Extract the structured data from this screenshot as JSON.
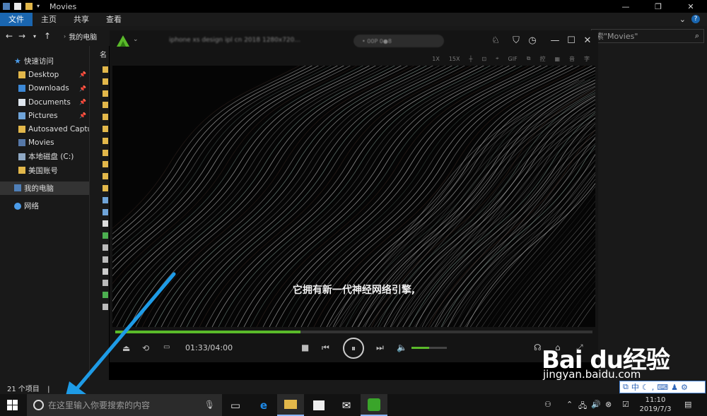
{
  "window": {
    "title": "Movies"
  },
  "ribbon": {
    "tabs": [
      "文件",
      "主页",
      "共享",
      "查看"
    ]
  },
  "search": {
    "placeholder": "索\"Movies\""
  },
  "address": {
    "crumb": "我的电脑"
  },
  "sidebar": {
    "quick_access": "快速访问",
    "items": [
      {
        "label": "Desktop",
        "pinned": true
      },
      {
        "label": "Downloads",
        "pinned": true
      },
      {
        "label": "Documents",
        "pinned": true
      },
      {
        "label": "Pictures",
        "pinned": true
      },
      {
        "label": "Autosaved Capture",
        "pinned": false
      },
      {
        "label": "Movies",
        "pinned": false
      },
      {
        "label": "本地磁盘 (C:)",
        "pinned": false
      },
      {
        "label": "美国账号",
        "pinned": false
      }
    ],
    "this_pc": "我的电脑",
    "network": "网络"
  },
  "filelist": {
    "header": "名"
  },
  "status": {
    "count": "21 个项目"
  },
  "player": {
    "title": "iphone xs design ipl cn 2018 1280x720...",
    "badge": "• 00P 0●8",
    "subtitle": "它拥有新一代神经网络引擎,",
    "time": "01:33/04:00",
    "progress": 0.388,
    "volume": 0.5,
    "tools": [
      "1X",
      "15X",
      "┼",
      "⊡",
      "⌖",
      "GIF",
      "⧉",
      "控",
      "▦",
      "音",
      "字"
    ],
    "accent": "#5aba2a"
  },
  "taskbar": {
    "search_placeholder": "在这里输入你要搜索的内容",
    "clock_time": "11:10",
    "clock_date": "2019/7/3"
  },
  "watermark": {
    "brand": "Bai du经验",
    "url": "jingyan.baidu.com"
  },
  "ime": {
    "mode": "中"
  }
}
